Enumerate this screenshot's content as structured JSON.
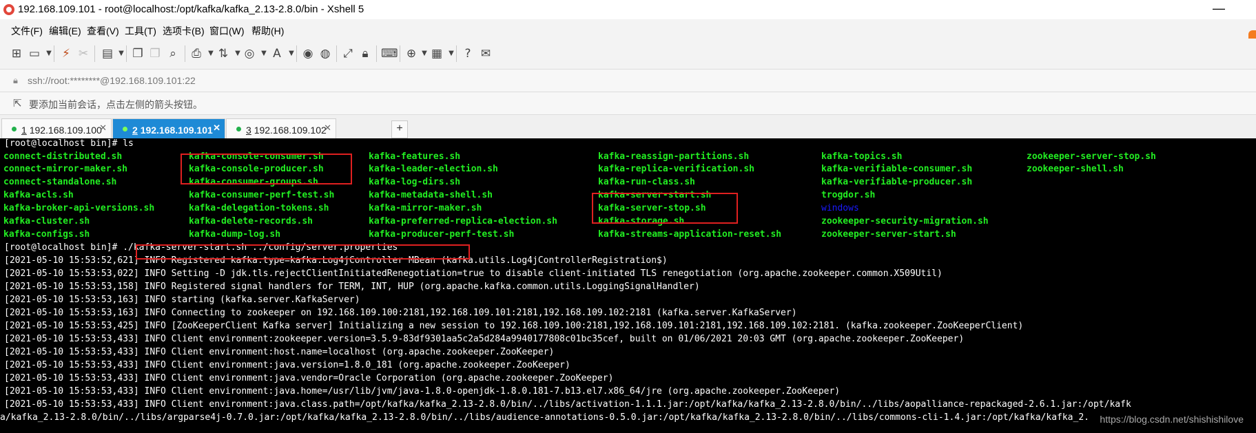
{
  "window": {
    "title": "192.168.109.101 - root@localhost:/opt/kafka/kafka_2.13-2.8.0/bin - Xshell 5",
    "minimize": "—"
  },
  "menu": [
    "文件(F)",
    "编辑(E)",
    "查看(V)",
    "工具(T)",
    "选项卡(B)",
    "窗口(W)",
    "帮助(H)"
  ],
  "address": "ssh://root:********@192.168.109.101:22",
  "hint": "要添加当前会话，点击左侧的箭头按钮。",
  "tabs": [
    {
      "num": "1",
      "host": "192.168.109.100",
      "active": false
    },
    {
      "num": "2",
      "host": "192.168.109.101",
      "active": true
    },
    {
      "num": "3",
      "host": "192.168.109.102",
      "active": false
    }
  ],
  "terminal": {
    "prompt_ls": "[root@localhost bin]# ls",
    "ls_columns": [
      [
        "connect-distributed.sh",
        "connect-mirror-maker.sh",
        "connect-standalone.sh",
        "kafka-acls.sh",
        "kafka-broker-api-versions.sh",
        "kafka-cluster.sh",
        "kafka-configs.sh"
      ],
      [
        "kafka-console-consumer.sh",
        "kafka-console-producer.sh",
        "kafka-consumer-groups.sh",
        "kafka-consumer-perf-test.sh",
        "kafka-delegation-tokens.sh",
        "kafka-delete-records.sh",
        "kafka-dump-log.sh"
      ],
      [
        "kafka-features.sh",
        "kafka-leader-election.sh",
        "kafka-log-dirs.sh",
        "kafka-metadata-shell.sh",
        "kafka-mirror-maker.sh",
        "kafka-preferred-replica-election.sh",
        "kafka-producer-perf-test.sh"
      ],
      [
        "kafka-reassign-partitions.sh",
        "kafka-replica-verification.sh",
        "kafka-run-class.sh",
        "kafka-server-start.sh",
        "kafka-server-stop.sh",
        "kafka-storage.sh",
        "kafka-streams-application-reset.sh"
      ],
      [
        "kafka-topics.sh",
        "kafka-verifiable-consumer.sh",
        "kafka-verifiable-producer.sh",
        "trogdor.sh",
        "windows",
        "zookeeper-security-migration.sh",
        "zookeeper-server-start.sh"
      ],
      [
        "zookeeper-server-stop.sh",
        "zookeeper-shell.sh"
      ]
    ],
    "prompt2": "[root@localhost bin]# ",
    "command": "./kafka-server-start.sh ../config/server.properties",
    "log": [
      "[2021-05-10 15:53:52,621] INFO Registered kafka:type=kafka.Log4jController MBean (kafka.utils.Log4jControllerRegistration$)",
      "[2021-05-10 15:53:53,022] INFO Setting -D jdk.tls.rejectClientInitiatedRenegotiation=true to disable client-initiated TLS renegotiation (org.apache.zookeeper.common.X509Util)",
      "[2021-05-10 15:53:53,158] INFO Registered signal handlers for TERM, INT, HUP (org.apache.kafka.common.utils.LoggingSignalHandler)",
      "[2021-05-10 15:53:53,163] INFO starting (kafka.server.KafkaServer)",
      "[2021-05-10 15:53:53,163] INFO Connecting to zookeeper on 192.168.109.100:2181,192.168.109.101:2181,192.168.109.102:2181 (kafka.server.KafkaServer)",
      "[2021-05-10 15:53:53,425] INFO [ZooKeeperClient Kafka server] Initializing a new session to 192.168.109.100:2181,192.168.109.101:2181,192.168.109.102:2181. (kafka.zookeeper.ZooKeeperClient)",
      "[2021-05-10 15:53:53,433] INFO Client environment:zookeeper.version=3.5.9-83df9301aa5c2a5d284a9940177808c01bc35cef, built on 01/06/2021 20:03 GMT (org.apache.zookeeper.ZooKeeper)",
      "[2021-05-10 15:53:53,433] INFO Client environment:host.name=localhost (org.apache.zookeeper.ZooKeeper)",
      "[2021-05-10 15:53:53,433] INFO Client environment:java.version=1.8.0_181 (org.apache.zookeeper.ZooKeeper)",
      "[2021-05-10 15:53:53,433] INFO Client environment:java.vendor=Oracle Corporation (org.apache.zookeeper.ZooKeeper)",
      "[2021-05-10 15:53:53,433] INFO Client environment:java.home=/usr/lib/jvm/java-1.8.0-openjdk-1.8.0.181-7.b13.el7.x86_64/jre (org.apache.zookeeper.ZooKeeper)",
      "[2021-05-10 15:53:53,433] INFO Client environment:java.class.path=/opt/kafka/kafka_2.13-2.8.0/bin/../libs/activation-1.1.1.jar:/opt/kafka/kafka_2.13-2.8.0/bin/../libs/aopalliance-repackaged-2.6.1.jar:/opt/kafk",
      "a/kafka_2.13-2.8.0/bin/../libs/argparse4j-0.7.0.jar:/opt/kafka/kafka_2.13-2.8.0/bin/../libs/audience-annotations-0.5.0.jar:/opt/kafka/kafka_2.13-2.8.0/bin/../libs/commons-cli-1.4.jar:/opt/kafka/kafka_2."
    ],
    "watermark": "https://blog.csdn.net/shishishilove"
  },
  "colors": {
    "accent_tab": "#1e8ad6",
    "file_green": "#22ee22",
    "dir_blue": "#1a1aff",
    "highlight_red": "#e02020"
  },
  "icons": [
    "new-session-icon",
    "open-folder-icon",
    "reconnect-icon",
    "disconnect-icon",
    "properties-icon",
    "copy-icon",
    "paste-icon",
    "find-icon",
    "print-icon",
    "transfer-icon",
    "globe-icon",
    "font-icon",
    "xftp-icon",
    "tunnel-icon",
    "fullscreen-icon",
    "lock-icon",
    "keyboard-icon",
    "compose-icon",
    "layout-icon",
    "help-icon",
    "chat-icon"
  ]
}
